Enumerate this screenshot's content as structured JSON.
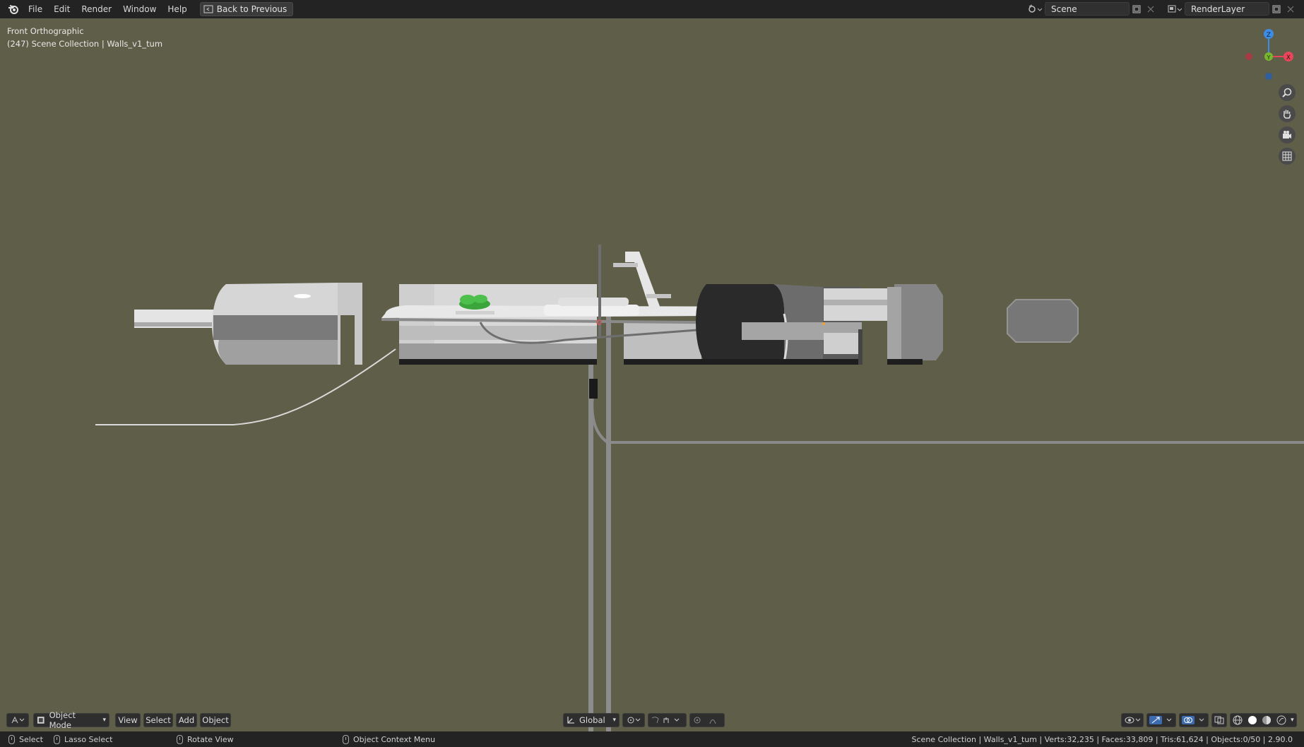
{
  "topbar": {
    "menu": [
      "File",
      "Edit",
      "Render",
      "Window",
      "Help"
    ],
    "back_label": "Back to Previous",
    "scene_value": "Scene",
    "renderlayer_value": "RenderLayer"
  },
  "viewport": {
    "view_name": "Front Orthographic",
    "collection_info": "(247) Scene Collection | Walls_v1_tum",
    "background_color": "#5f5e49"
  },
  "gizmo": {
    "z_label": "Z",
    "y_label": "Y",
    "x_label": "X",
    "colors": {
      "x": "#e8465a",
      "y": "#78b62e",
      "z": "#3d8ce6"
    }
  },
  "header": {
    "mode_label": "Object Mode",
    "view_label": "View",
    "select_label": "Select",
    "add_label": "Add",
    "object_label": "Object",
    "orientation_label": "Global"
  },
  "statusbar": {
    "select_label": "Select",
    "lasso_label": "Lasso Select",
    "rotate_label": "Rotate View",
    "context_label": "Object Context Menu",
    "stats": "Scene Collection | Walls_v1_tum | Verts:32,235 | Faces:33,809 | Tris:61,624 | Objects:0/50 | 2.90.0"
  }
}
